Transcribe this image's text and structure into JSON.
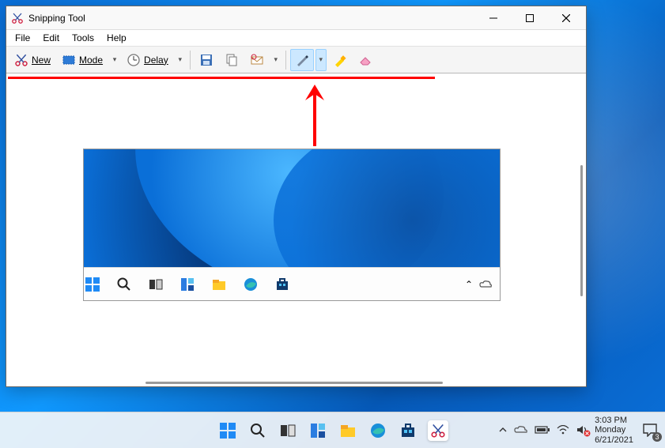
{
  "window": {
    "title": "Snipping Tool",
    "menus": [
      "File",
      "Edit",
      "Tools",
      "Help"
    ],
    "toolbar": {
      "new_label": "New",
      "mode_label": "Mode",
      "delay_label": "Delay"
    }
  },
  "taskbar": {
    "clock_time": "3:03 PM",
    "clock_day": "Monday",
    "clock_date": "6/21/2021",
    "notification_count": "3"
  },
  "snapshot": {
    "tray_chevron": "⌃"
  }
}
